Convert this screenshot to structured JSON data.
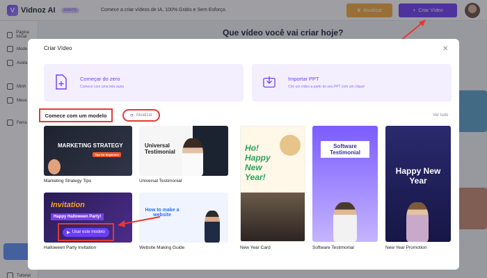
{
  "app": {
    "name": "Vidnoz AI",
    "badge": "GRÁTIS",
    "tagline": "Comece a criar vídeos de IA, 100% Grátis e Sem Esforço.",
    "upgrade_label": "Atualizar",
    "create_label": "Criar Vídeo"
  },
  "sidebar": {
    "items": [
      {
        "label": "Página Inicial"
      },
      {
        "label": "Mode"
      },
      {
        "label": "Avata"
      },
      {
        "label": "Minh"
      },
      {
        "label": "Meus"
      },
      {
        "label": "Ferra"
      },
      {
        "label": "Tutorial"
      }
    ]
  },
  "main": {
    "title": "Que vídeo você vai criar hoje?"
  },
  "modal": {
    "title": "Criar Vídeo",
    "close_icon": "close-icon",
    "options": [
      {
        "title": "Começar do zero",
        "subtitle": "Comece com uma tela vazia"
      },
      {
        "title": "Importar PPT",
        "subtitle": "Crie um vídeo a partir do seu PPT com um clique!"
      }
    ],
    "section_label": "Comece com um modelo",
    "refresh_label": "Atualizar",
    "see_all": "Ver tudo",
    "use_template_label": "Usar este modelo",
    "templates": [
      {
        "label": "Marketing Strategy Tips",
        "thumb_text": "MARKETING STRATEGY",
        "thumb_sub": "Tips for beginners"
      },
      {
        "label": "Universal Testimonial",
        "thumb_text": "Universal Testimonial"
      },
      {
        "label": "Halloween Party Invitation",
        "thumb_text": "Invitation",
        "thumb_sub": "Happy Halloween Party!"
      },
      {
        "label": "Website Making Guide",
        "thumb_text": "How to make a website"
      },
      {
        "label": "New Year Card",
        "thumb_text": "Ho! Happy New Year!"
      },
      {
        "label": "Software Testimonial",
        "thumb_text": "Software Testimonial"
      },
      {
        "label": "New Year Promotion",
        "thumb_text": "Happy New Year"
      }
    ]
  },
  "colors": {
    "accent": "#6d3df5",
    "upgrade": "#f4a93a",
    "highlight": "#e53935"
  }
}
